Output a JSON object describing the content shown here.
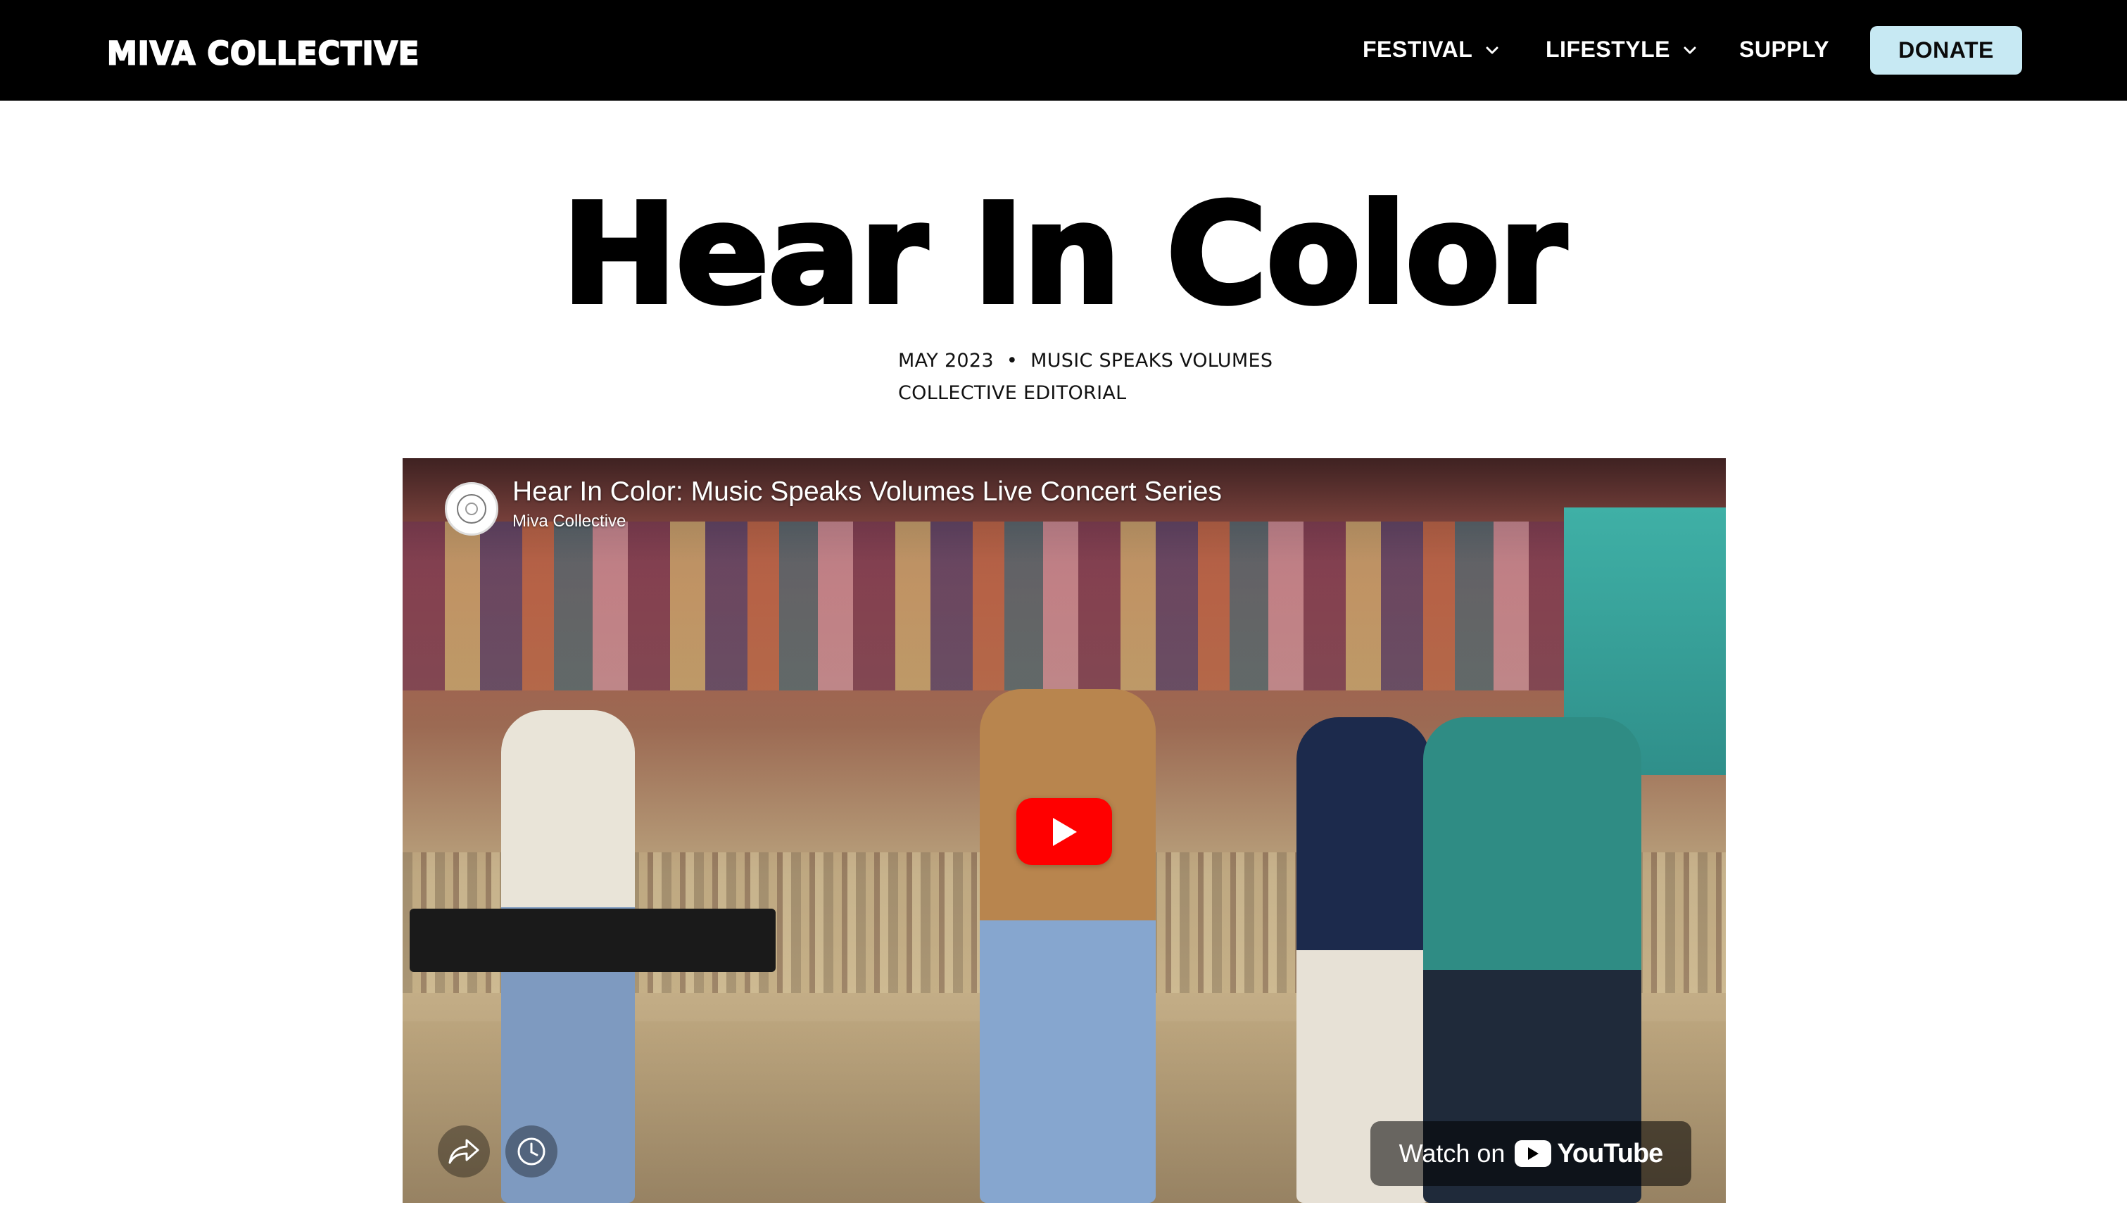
{
  "header": {
    "logo": "MIVA COLLECTIVE",
    "nav": [
      {
        "label": "FESTIVAL",
        "has_dropdown": true
      },
      {
        "label": "LIFESTYLE",
        "has_dropdown": true
      },
      {
        "label": "SUPPLY",
        "has_dropdown": false
      }
    ],
    "donate_label": "DONATE",
    "colors": {
      "bar": "#000000",
      "donate_bg": "#c7e9f3"
    }
  },
  "article": {
    "title": "Hear In Color",
    "date": "MAY 2023",
    "separator": "•",
    "category": "MUSIC SPEAKS VOLUMES",
    "author": "COLLECTIVE EDITORIAL"
  },
  "video": {
    "title": "Hear In Color: Music Speaks Volumes Live Concert Series",
    "channel": "Miva Collective",
    "watch_on": "Watch on",
    "platform": "YouTube",
    "icons": [
      "play-icon",
      "share-icon",
      "clock-icon",
      "youtube-logo-icon"
    ],
    "play_color": "#ff0000"
  }
}
